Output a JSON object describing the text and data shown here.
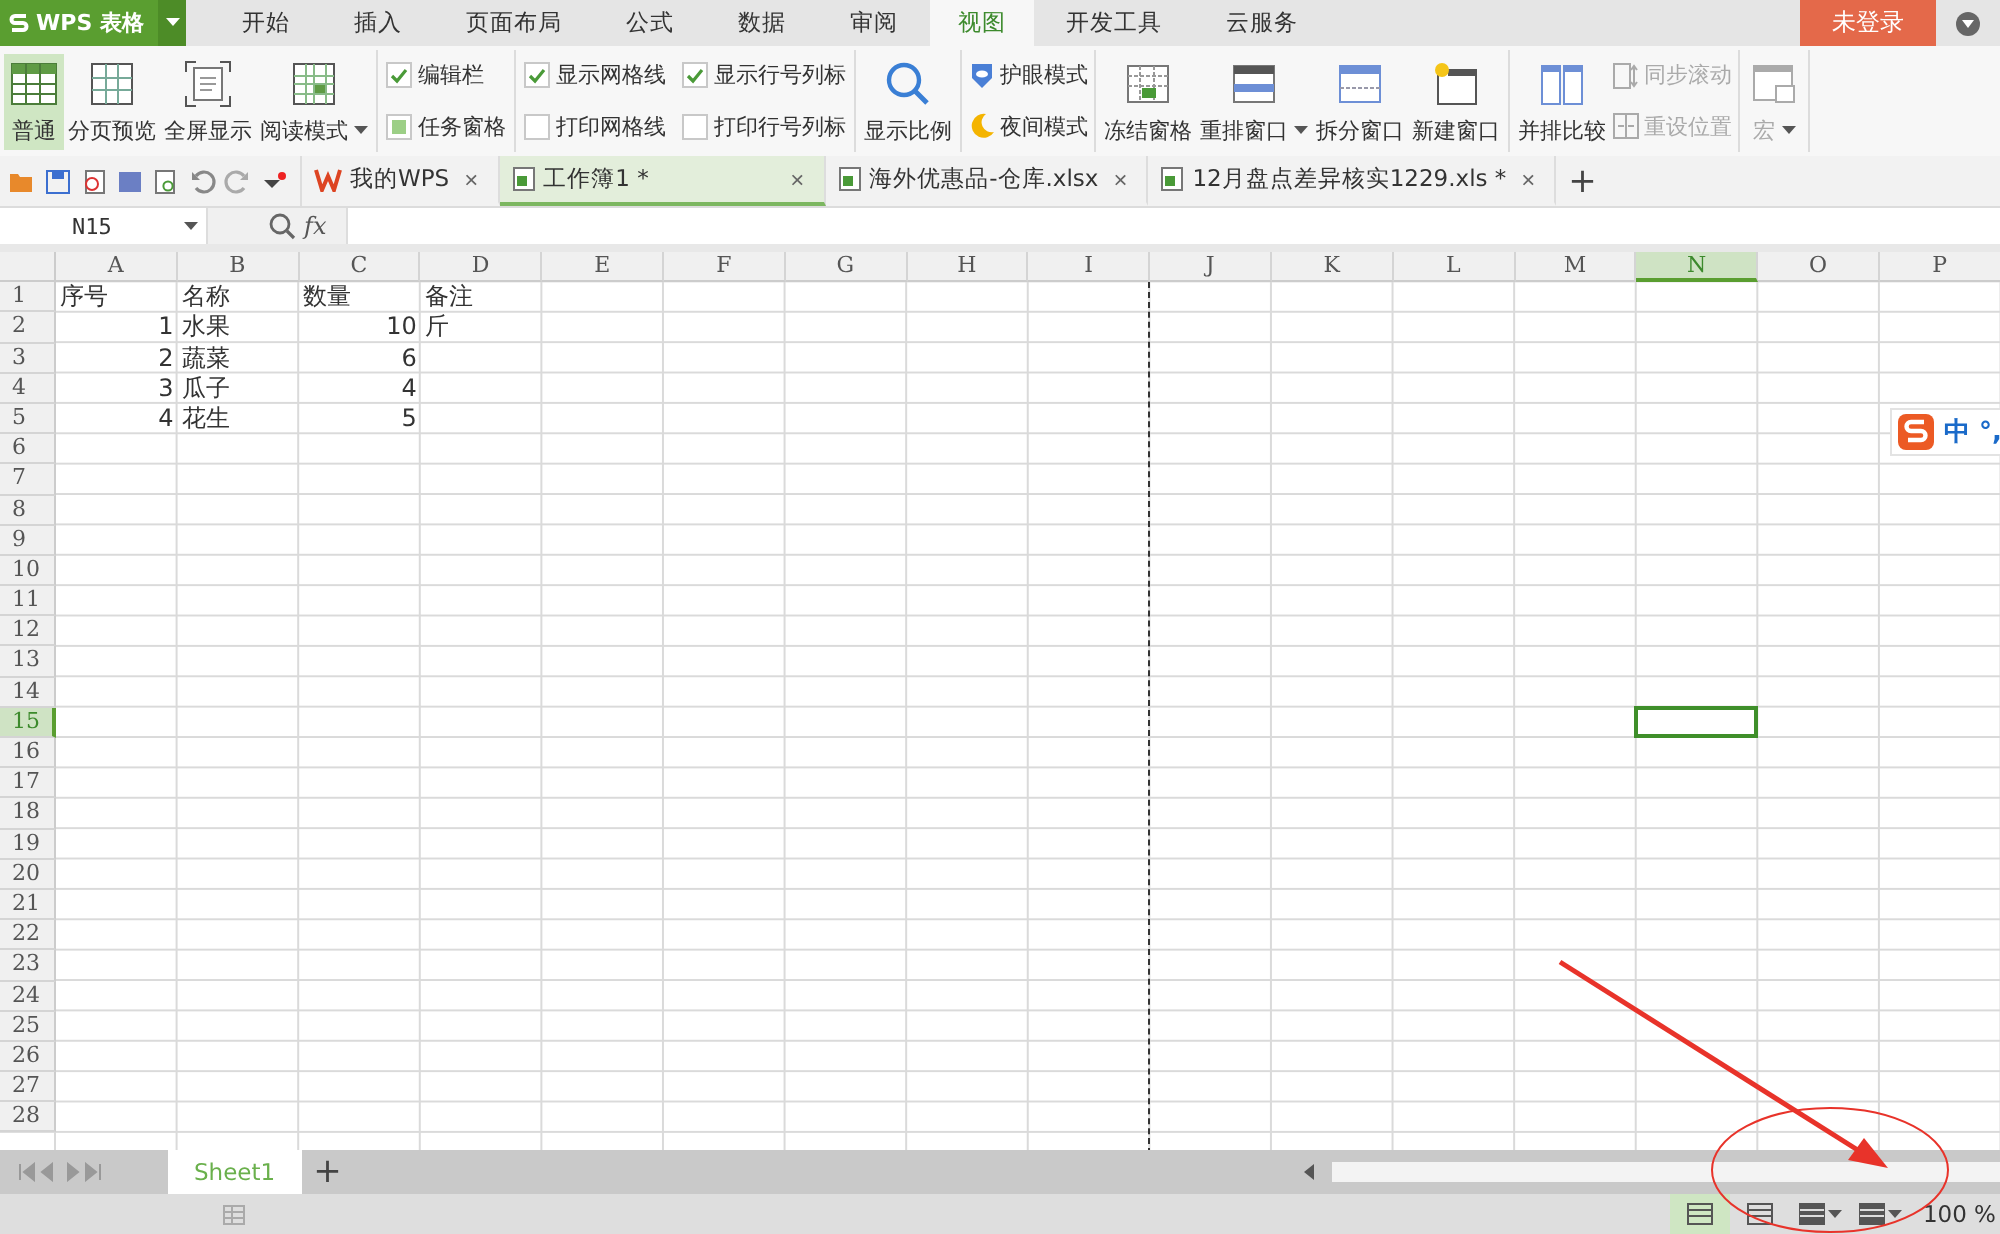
{
  "app_button": {
    "label": "WPS 表格"
  },
  "menu_tabs": [
    {
      "label": "开始",
      "selected": false
    },
    {
      "label": "插入",
      "selected": false
    },
    {
      "label": "页面布局",
      "selected": false
    },
    {
      "label": "公式",
      "selected": false
    },
    {
      "label": "数据",
      "selected": false
    },
    {
      "label": "审阅",
      "selected": false
    },
    {
      "label": "视图",
      "selected": true
    },
    {
      "label": "开发工具",
      "selected": false
    },
    {
      "label": "云服务",
      "selected": false
    }
  ],
  "login_button": {
    "label": "未登录"
  },
  "ribbon": [
    {
      "items": [
        {
          "kind": "big",
          "label": "普通",
          "selected": true
        },
        {
          "kind": "big",
          "label": "分页预览",
          "selected": false
        },
        {
          "kind": "big",
          "label": "全屏显示",
          "selected": false
        },
        {
          "kind": "big",
          "label": "阅读模式",
          "selected": false,
          "dropdown": true
        }
      ]
    },
    {
      "items": [
        {
          "kind": "check",
          "label": "编辑栏",
          "checked": true
        },
        {
          "kind": "fill",
          "label": "任务窗格",
          "checked": true
        }
      ]
    },
    {
      "items": [
        {
          "kind": "check",
          "label": "显示网格线",
          "checked": true
        },
        {
          "kind": "check",
          "label": "打印网格线",
          "checked": false
        },
        {
          "kind": "check",
          "label": "显示行号列标",
          "checked": true
        },
        {
          "kind": "check",
          "label": "打印行号列标",
          "checked": false
        }
      ]
    },
    {
      "items": [
        {
          "kind": "big",
          "label": "显示比例",
          "selected": false
        }
      ]
    },
    {
      "items": [
        {
          "kind": "small",
          "label": "护眼模式",
          "disabled": false
        },
        {
          "kind": "small",
          "label": "夜间模式",
          "disabled": false
        }
      ]
    },
    {
      "items": [
        {
          "kind": "big",
          "label": "冻结窗格",
          "selected": false
        },
        {
          "kind": "big",
          "label": "重排窗口",
          "selected": false,
          "dropdown": true
        },
        {
          "kind": "big",
          "label": "拆分窗口",
          "selected": false
        },
        {
          "kind": "big",
          "label": "新建窗口",
          "selected": false
        }
      ]
    },
    {
      "items": [
        {
          "kind": "big",
          "label": "并排比较",
          "selected": false
        },
        {
          "kind": "small",
          "label": "同步滚动",
          "disabled": true
        },
        {
          "kind": "small",
          "label": "重设位置",
          "disabled": true
        }
      ]
    },
    {
      "items": [
        {
          "kind": "big",
          "label": "宏",
          "selected": false,
          "dropdown": true,
          "disabled": true
        }
      ]
    }
  ],
  "doc_tabs": [
    {
      "label": "我的WPS",
      "kind": "home",
      "selected": false,
      "close": "×"
    },
    {
      "label": "工作簿1 *",
      "kind": "sheet",
      "selected": true,
      "close": "×"
    },
    {
      "label": "海外优惠品-仓库.xlsx",
      "kind": "sheet",
      "selected": false,
      "close": "×"
    },
    {
      "label": "12月盘点差异核实1229.xls *",
      "kind": "sheet",
      "selected": false,
      "close": "×"
    }
  ],
  "new_tab": "+",
  "formula_bar": {
    "name_box": "N15",
    "fx": "fx"
  },
  "columns": [
    {
      "label": "A",
      "selected": false
    },
    {
      "label": "B",
      "selected": false
    },
    {
      "label": "C",
      "selected": false
    },
    {
      "label": "D",
      "selected": false
    },
    {
      "label": "E",
      "selected": false
    },
    {
      "label": "F",
      "selected": false
    },
    {
      "label": "G",
      "selected": false
    },
    {
      "label": "H",
      "selected": false
    },
    {
      "label": "I",
      "selected": false,
      "page_break": true
    },
    {
      "label": "J",
      "selected": false
    },
    {
      "label": "K",
      "selected": false
    },
    {
      "label": "L",
      "selected": false
    },
    {
      "label": "M",
      "selected": false
    },
    {
      "label": "N",
      "selected": true
    },
    {
      "label": "O",
      "selected": false
    },
    {
      "label": "P",
      "selected": false
    }
  ],
  "rows": [
    {
      "label": "1",
      "selected": false,
      "cells": [
        {
          "text": "序号",
          "kind": "text"
        },
        {
          "text": "名称",
          "kind": "text"
        },
        {
          "text": "数量",
          "kind": "text"
        },
        {
          "text": "备注",
          "kind": "text"
        }
      ]
    },
    {
      "label": "2",
      "selected": false,
      "cells": [
        {
          "text": "1",
          "kind": "number"
        },
        {
          "text": "水果",
          "kind": "text"
        },
        {
          "text": "10",
          "kind": "number"
        },
        {
          "text": "斤",
          "kind": "text"
        }
      ]
    },
    {
      "label": "3",
      "selected": false,
      "cells": [
        {
          "text": "2",
          "kind": "number"
        },
        {
          "text": "蔬菜",
          "kind": "text"
        },
        {
          "text": "6",
          "kind": "number"
        }
      ]
    },
    {
      "label": "4",
      "selected": false,
      "cells": [
        {
          "text": "3",
          "kind": "number"
        },
        {
          "text": "瓜子",
          "kind": "text"
        },
        {
          "text": "4",
          "kind": "number"
        }
      ]
    },
    {
      "label": "5",
      "selected": false,
      "cells": [
        {
          "text": "4",
          "kind": "number"
        },
        {
          "text": "花生",
          "kind": "text"
        },
        {
          "text": "5",
          "kind": "number"
        }
      ]
    },
    {
      "label": "6",
      "selected": false
    },
    {
      "label": "7",
      "selected": false
    },
    {
      "label": "8",
      "selected": false
    },
    {
      "label": "9",
      "selected": false
    },
    {
      "label": "10",
      "selected": false
    },
    {
      "label": "11",
      "selected": false
    },
    {
      "label": "12",
      "selected": false
    },
    {
      "label": "13",
      "selected": false
    },
    {
      "label": "14",
      "selected": false
    },
    {
      "label": "15",
      "selected": true
    },
    {
      "label": "16",
      "selected": false
    },
    {
      "label": "17",
      "selected": false
    },
    {
      "label": "18",
      "selected": false
    },
    {
      "label": "19",
      "selected": false
    },
    {
      "label": "20",
      "selected": false
    },
    {
      "label": "21",
      "selected": false
    },
    {
      "label": "22",
      "selected": false
    },
    {
      "label": "23",
      "selected": false
    },
    {
      "label": "24",
      "selected": false
    },
    {
      "label": "25",
      "selected": false
    },
    {
      "label": "26",
      "selected": false
    },
    {
      "label": "27",
      "selected": false
    },
    {
      "label": "28",
      "selected": false
    }
  ],
  "ime": {
    "mode": "中",
    "punct": "°,"
  },
  "sheet_tabs": [
    {
      "label": "Sheet1",
      "selected": true
    }
  ],
  "add_sheet": "+",
  "status_bar": {
    "views": [
      {
        "selected": true
      },
      {
        "selected": false
      },
      {
        "selected": false,
        "dropdown": true
      },
      {
        "selected": false,
        "dropdown": true
      }
    ],
    "zoom": "100 %"
  }
}
